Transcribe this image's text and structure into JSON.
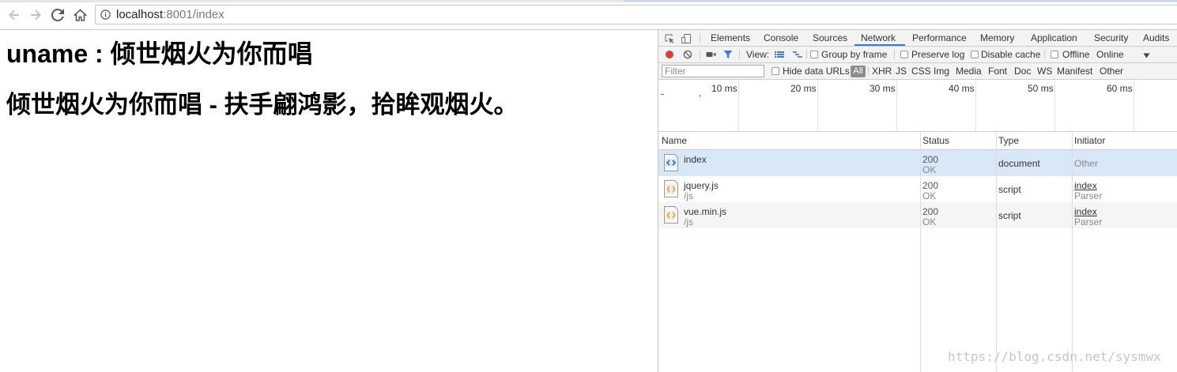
{
  "browser": {
    "url_host": "localhost",
    "url_rest": ":8001/index",
    "icons": [
      "back-arrow-icon",
      "forward-arrow-icon",
      "reload-icon",
      "home-icon",
      "info-icon"
    ]
  },
  "page": {
    "heading_1": "uname : 倾世烟火为你而唱",
    "heading_2": "倾世烟火为你而唱 - 扶手翩鸿影，拾眸观烟火。"
  },
  "devtools": {
    "tabs": [
      {
        "label": "Elements"
      },
      {
        "label": "Console"
      },
      {
        "label": "Sources"
      },
      {
        "label": "Network",
        "active": true
      },
      {
        "label": "Performance"
      },
      {
        "label": "Memory"
      },
      {
        "label": "Application"
      },
      {
        "label": "Security"
      },
      {
        "label": "Audits"
      }
    ],
    "network_toolbar": {
      "recording": true,
      "view_label": "View:",
      "group_by_frame": {
        "label": "Group by frame",
        "checked": false
      },
      "preserve_log": {
        "label": "Preserve log",
        "checked": false
      },
      "disable_cache": {
        "label": "Disable cache",
        "checked": false
      },
      "offline": {
        "label": "Offline",
        "checked": false
      },
      "throttling": "Online"
    },
    "filter_bar": {
      "filter_placeholder": "Filter",
      "hide_data_urls": {
        "label": "Hide data URLs",
        "checked": false
      },
      "types": [
        "All",
        "XHR",
        "JS",
        "CSS",
        "Img",
        "Media",
        "Font",
        "Doc",
        "WS",
        "Manifest",
        "Other"
      ],
      "selected_type_index": 0
    },
    "overview": {
      "ticks": [
        "10 ms",
        "20 ms",
        "30 ms",
        "40 ms",
        "50 ms",
        "60 ms"
      ]
    },
    "table": {
      "columns": [
        "Name",
        "Status",
        "Type",
        "Initiator"
      ],
      "rows": [
        {
          "icon": "document-file-icon",
          "name": "index",
          "status_code": "200",
          "status_text": "OK",
          "type": "document",
          "initiator": "Other",
          "selected": true
        },
        {
          "icon": "script-file-icon",
          "name": "jquery.js",
          "path": "/js",
          "status_code": "200",
          "status_text": "OK",
          "type": "script",
          "initiator": "index",
          "initiator_detail": "Parser",
          "selected": false
        },
        {
          "icon": "script-file-icon",
          "name": "vue.min.js",
          "path": "/js",
          "status_code": "200",
          "status_text": "OK",
          "type": "script",
          "initiator": "index",
          "initiator_detail": "Parser",
          "selected": false
        }
      ]
    }
  },
  "watermark": "https://blog.csdn.net/sysmwx",
  "colors": {
    "accent": "#3879d9",
    "record": "#e03c31",
    "selected_row": "#d9e8f9",
    "alt_row": "#f5f5f5",
    "toolbar_bg": "#f3f3f3"
  }
}
